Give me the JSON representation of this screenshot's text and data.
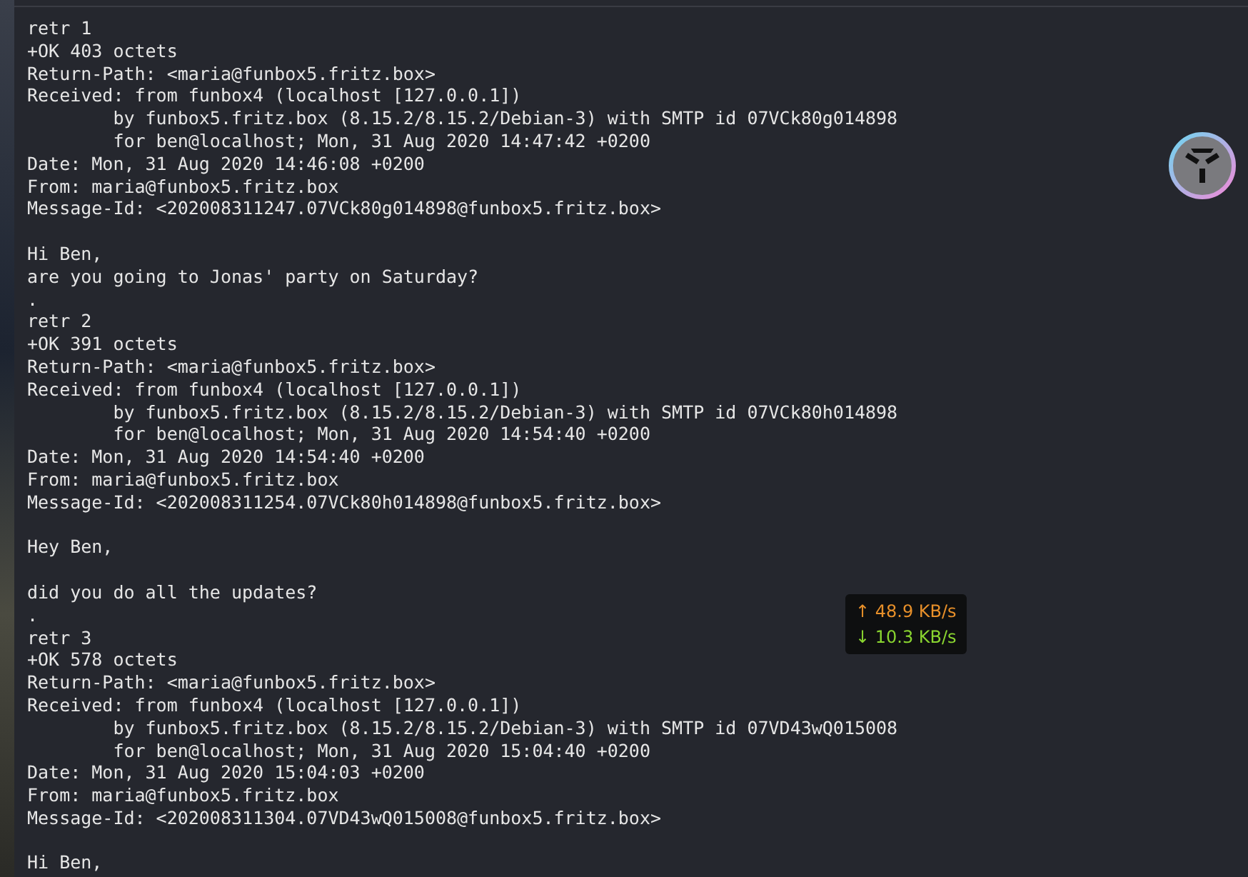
{
  "terminal": {
    "lines": [
      {
        "kind": "text",
        "text": "retr 1"
      },
      {
        "kind": "text",
        "text": "+OK 403 octets"
      },
      {
        "kind": "text",
        "text": "Return-Path: <maria@funbox5.fritz.box>"
      },
      {
        "kind": "text",
        "text": "Received: from funbox4 (localhost [127.0.0.1])"
      },
      {
        "kind": "text",
        "text": "        by funbox5.fritz.box (8.15.2/8.15.2/Debian-3) with SMTP id 07VCk80g014898"
      },
      {
        "kind": "text",
        "text": "        for ben@localhost; Mon, 31 Aug 2020 14:47:42 +0200"
      },
      {
        "kind": "text",
        "text": "Date: Mon, 31 Aug 2020 14:46:08 +0200"
      },
      {
        "kind": "text",
        "text": "From: maria@funbox5.fritz.box"
      },
      {
        "kind": "text",
        "text": "Message-Id: <202008311247.07VCk80g014898@funbox5.fritz.box>"
      },
      {
        "kind": "blank"
      },
      {
        "kind": "text",
        "text": "Hi Ben,"
      },
      {
        "kind": "text",
        "text": "are you going to Jonas' party on Saturday?"
      },
      {
        "kind": "text",
        "text": "."
      },
      {
        "kind": "text",
        "text": "retr 2"
      },
      {
        "kind": "text",
        "text": "+OK 391 octets"
      },
      {
        "kind": "text",
        "text": "Return-Path: <maria@funbox5.fritz.box>"
      },
      {
        "kind": "text",
        "text": "Received: from funbox4 (localhost [127.0.0.1])"
      },
      {
        "kind": "text",
        "text": "        by funbox5.fritz.box (8.15.2/8.15.2/Debian-3) with SMTP id 07VCk80h014898"
      },
      {
        "kind": "text",
        "text": "        for ben@localhost; Mon, 31 Aug 2020 14:54:40 +0200"
      },
      {
        "kind": "text",
        "text": "Date: Mon, 31 Aug 2020 14:54:40 +0200"
      },
      {
        "kind": "text",
        "text": "From: maria@funbox5.fritz.box"
      },
      {
        "kind": "text",
        "text": "Message-Id: <202008311254.07VCk80h014898@funbox5.fritz.box>"
      },
      {
        "kind": "blank"
      },
      {
        "kind": "text",
        "text": "Hey Ben,"
      },
      {
        "kind": "blank"
      },
      {
        "kind": "text",
        "text": "did you do all the updates?"
      },
      {
        "kind": "text",
        "text": "."
      },
      {
        "kind": "text",
        "text": "retr 3"
      },
      {
        "kind": "text",
        "text": "+OK 578 octets"
      },
      {
        "kind": "text",
        "text": "Return-Path: <maria@funbox5.fritz.box>"
      },
      {
        "kind": "text",
        "text": "Received: from funbox4 (localhost [127.0.0.1])"
      },
      {
        "kind": "text",
        "text": "        by funbox5.fritz.box (8.15.2/8.15.2/Debian-3) with SMTP id 07VD43wQ015008"
      },
      {
        "kind": "text",
        "text": "        for ben@localhost; Mon, 31 Aug 2020 15:04:40 +0200"
      },
      {
        "kind": "text",
        "text": "Date: Mon, 31 Aug 2020 15:04:03 +0200"
      },
      {
        "kind": "text",
        "text": "From: maria@funbox5.fritz.box"
      },
      {
        "kind": "text",
        "text": "Message-Id: <202008311304.07VD43wQ015008@funbox5.fritz.box>"
      },
      {
        "kind": "blank"
      },
      {
        "kind": "text",
        "text": "Hi Ben,"
      }
    ]
  },
  "network_monitor": {
    "upload": {
      "arrow": "↑",
      "rate": "48.9 KB/s"
    },
    "download": {
      "arrow": "↓",
      "rate": "10.3 KB/s"
    }
  }
}
